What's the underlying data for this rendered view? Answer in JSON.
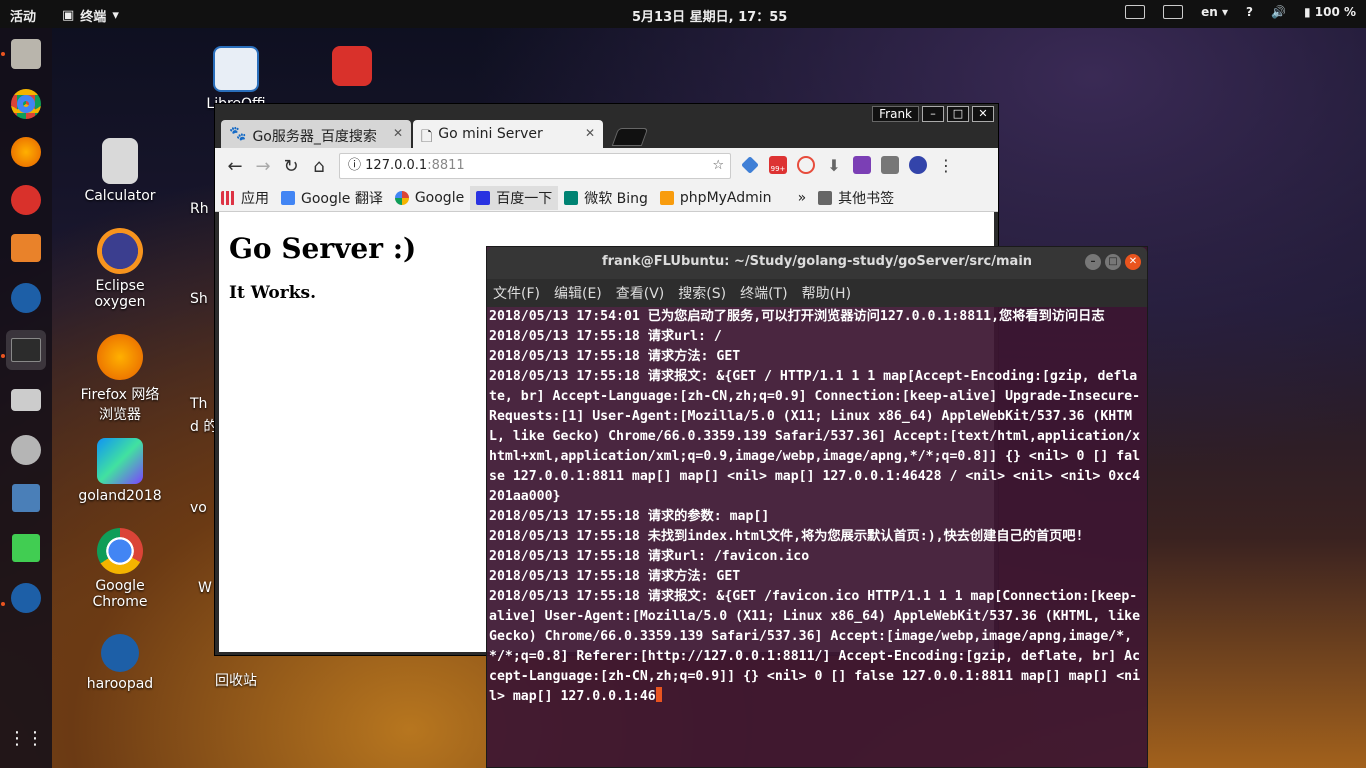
{
  "topbar": {
    "activities": "活动",
    "app_name": "终端",
    "clock": "5月13日 星期日, 17：55",
    "lang": "en",
    "help": "?",
    "battery": "100 %"
  },
  "desktop": {
    "libreoffice": "LibreOffi",
    "calculator": "Calculator",
    "eclipse": "Eclipse oxygen",
    "firefox": "Firefox 网络浏览器",
    "goland": "goland2018",
    "chrome": "Google Chrome",
    "haroopad": "haroopad",
    "trash": "回收站",
    "partial": [
      "Rh",
      "Sh",
      "Th",
      "d 的",
      "vo",
      "W"
    ]
  },
  "browser": {
    "user": "Frank",
    "tabs": [
      {
        "label": "Go服务器_百度搜索"
      },
      {
        "label": "Go mini Server"
      }
    ],
    "url_host": "127.0.0.1",
    "url_port": ":8811",
    "bookmarks": [
      "应用",
      "Google 翻译",
      "Google",
      "百度一下",
      "微软 Bing",
      "phpMyAdmin"
    ],
    "more_bookmarks": "»",
    "other_bookmarks": "其他书签",
    "badge": "99+",
    "page_h1": "Go Server :)",
    "page_h4": "It Works."
  },
  "terminal": {
    "title": "frank@FLUbuntu: ~/Study/golang-study/goServer/src/main",
    "menu": [
      "文件(F)",
      "编辑(E)",
      "查看(V)",
      "搜索(S)",
      "终端(T)",
      "帮助(H)"
    ],
    "output": "2018/05/13 17:54:01 已为您启动了服务,可以打开浏览器访问127.0.0.1:8811,您将看到访问日志\n2018/05/13 17:55:18 请求url: /\n2018/05/13 17:55:18 请求方法: GET\n2018/05/13 17:55:18 请求报文: &{GET / HTTP/1.1 1 1 map[Accept-Encoding:[gzip, deflate, br] Accept-Language:[zh-CN,zh;q=0.9] Connection:[keep-alive] Upgrade-Insecure-Requests:[1] User-Agent:[Mozilla/5.0 (X11; Linux x86_64) AppleWebKit/537.36 (KHTML, like Gecko) Chrome/66.0.3359.139 Safari/537.36] Accept:[text/html,application/xhtml+xml,application/xml;q=0.9,image/webp,image/apng,*/*;q=0.8]] {} <nil> 0 [] false 127.0.0.1:8811 map[] map[] <nil> map[] 127.0.0.1:46428 / <nil> <nil> <nil> 0xc4201aa000}\n2018/05/13 17:55:18 请求的参数: map[]\n2018/05/13 17:55:18 未找到index.html文件,将为您展示默认首页:),快去创建自己的首页吧!\n2018/05/13 17:55:18 请求url: /favicon.ico\n2018/05/13 17:55:18 请求方法: GET\n2018/05/13 17:55:18 请求报文: &{GET /favicon.ico HTTP/1.1 1 1 map[Connection:[keep-alive] User-Agent:[Mozilla/5.0 (X11; Linux x86_64) AppleWebKit/537.36 (KHTML, like Gecko) Chrome/66.0.3359.139 Safari/537.36] Accept:[image/webp,image/apng,image/*,*/*;q=0.8] Referer:[http://127.0.0.1:8811/] Accept-Encoding:[gzip, deflate, br] Accept-Language:[zh-CN,zh;q=0.9]] {} <nil> 0 [] false 127.0.0.1:8811 map[] map[] <nil> map[] 127.0.0.1:46"
  },
  "colors": {
    "ubuntu_orange": "#e95420",
    "terminal_bg": "#3c1632"
  }
}
